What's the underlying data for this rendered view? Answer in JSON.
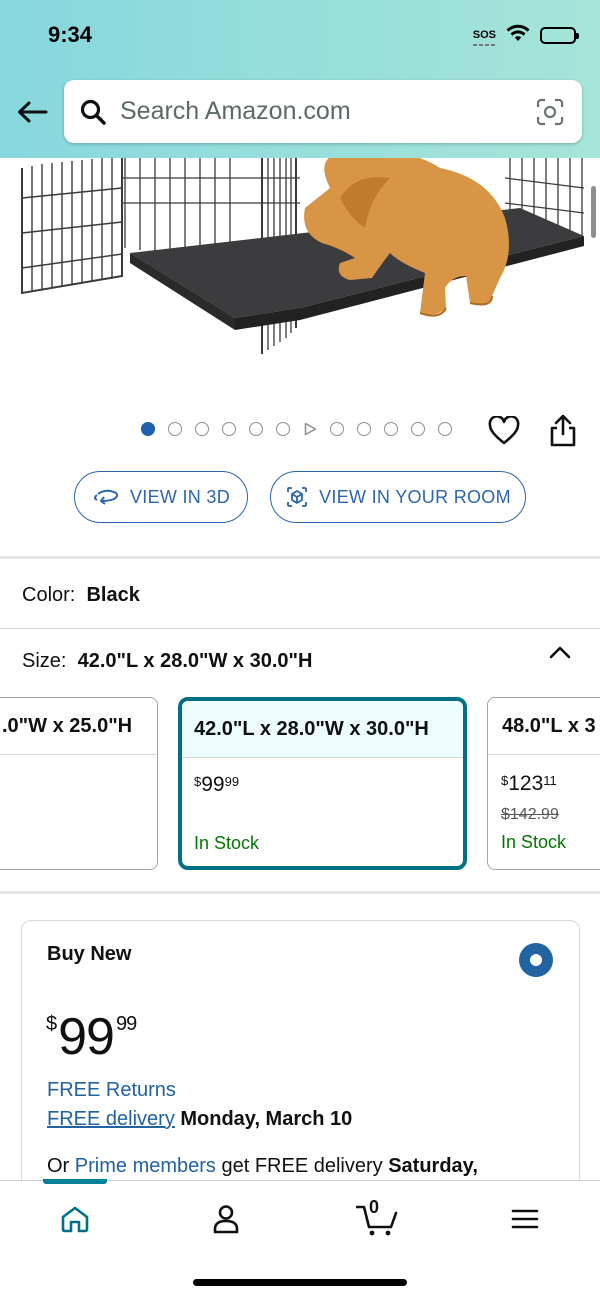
{
  "status_bar": {
    "time": "9:34",
    "sos": "SOS"
  },
  "search": {
    "placeholder": "Search Amazon.com"
  },
  "carousel": {
    "dot_count": 12,
    "active_index": 0,
    "video_index": 6
  },
  "actions": {
    "view_3d": "VIEW IN 3D",
    "view_room": "VIEW IN YOUR ROOM"
  },
  "color": {
    "label": "Color:",
    "value": "Black"
  },
  "size": {
    "label": "Size:",
    "value": "42.0\"L x 28.0\"W x 30.0\"H",
    "options": [
      {
        "name": ".0\"W x 25.0\"H"
      },
      {
        "name": "42.0\"L x 28.0\"W x 30.0\"H",
        "price_symbol": "$",
        "price_whole": "99",
        "price_cents": "99",
        "stock": "In Stock",
        "selected": true
      },
      {
        "name": "48.0\"L x 3",
        "price_symbol": "$",
        "price_whole": "123",
        "price_cents": "11",
        "list_price": "$142.99",
        "stock": "In Stock"
      }
    ]
  },
  "buy_box": {
    "title": "Buy New",
    "price_symbol": "$",
    "price_whole": "99",
    "price_cents": "99",
    "free_returns": "FREE Returns",
    "free_delivery_link": "FREE delivery",
    "delivery_date": "Monday, March 10",
    "prime_prefix": "Or",
    "prime_link": "Prime members",
    "prime_middle": "get FREE delivery",
    "prime_date": "Saturday,"
  },
  "bottom_nav": {
    "cart_count": "0",
    "active": "home"
  },
  "colors": {
    "header_gradient_start": "#86d7de",
    "header_gradient_end": "#a6e5d8",
    "link_blue": "#2162a1",
    "selected_teal": "#007185",
    "in_stock_green": "#007600"
  }
}
